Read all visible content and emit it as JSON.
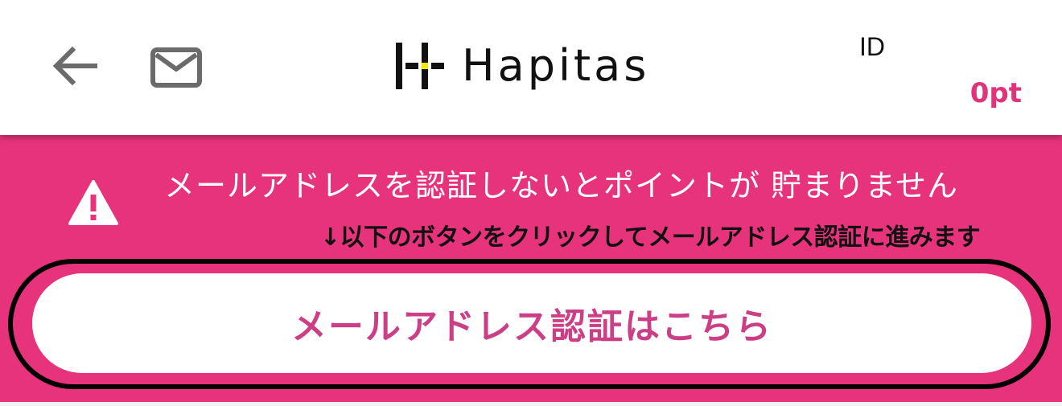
{
  "header": {
    "back_icon": "arrow-left-icon",
    "mail_icon": "mail-icon",
    "logo_text": "Hapitas",
    "user_id_label": "ID",
    "points": "0pt"
  },
  "banner": {
    "warning_icon": "warning-icon",
    "warning_text": "メールアドレスを認証しないとポイントが 貯まりません",
    "hint_text": "↓以下のボタンをクリックしてメールアドレス認証に進みます",
    "verify_button_label": "メールアドレス認証はこちら"
  },
  "colors": {
    "brand_pink": "#e6337c",
    "points_pink": "#e0337b",
    "button_text_pink": "#cc3f86",
    "logo_accent_yellow": "#f2e600",
    "icon_gray": "#6b6b6b"
  }
}
